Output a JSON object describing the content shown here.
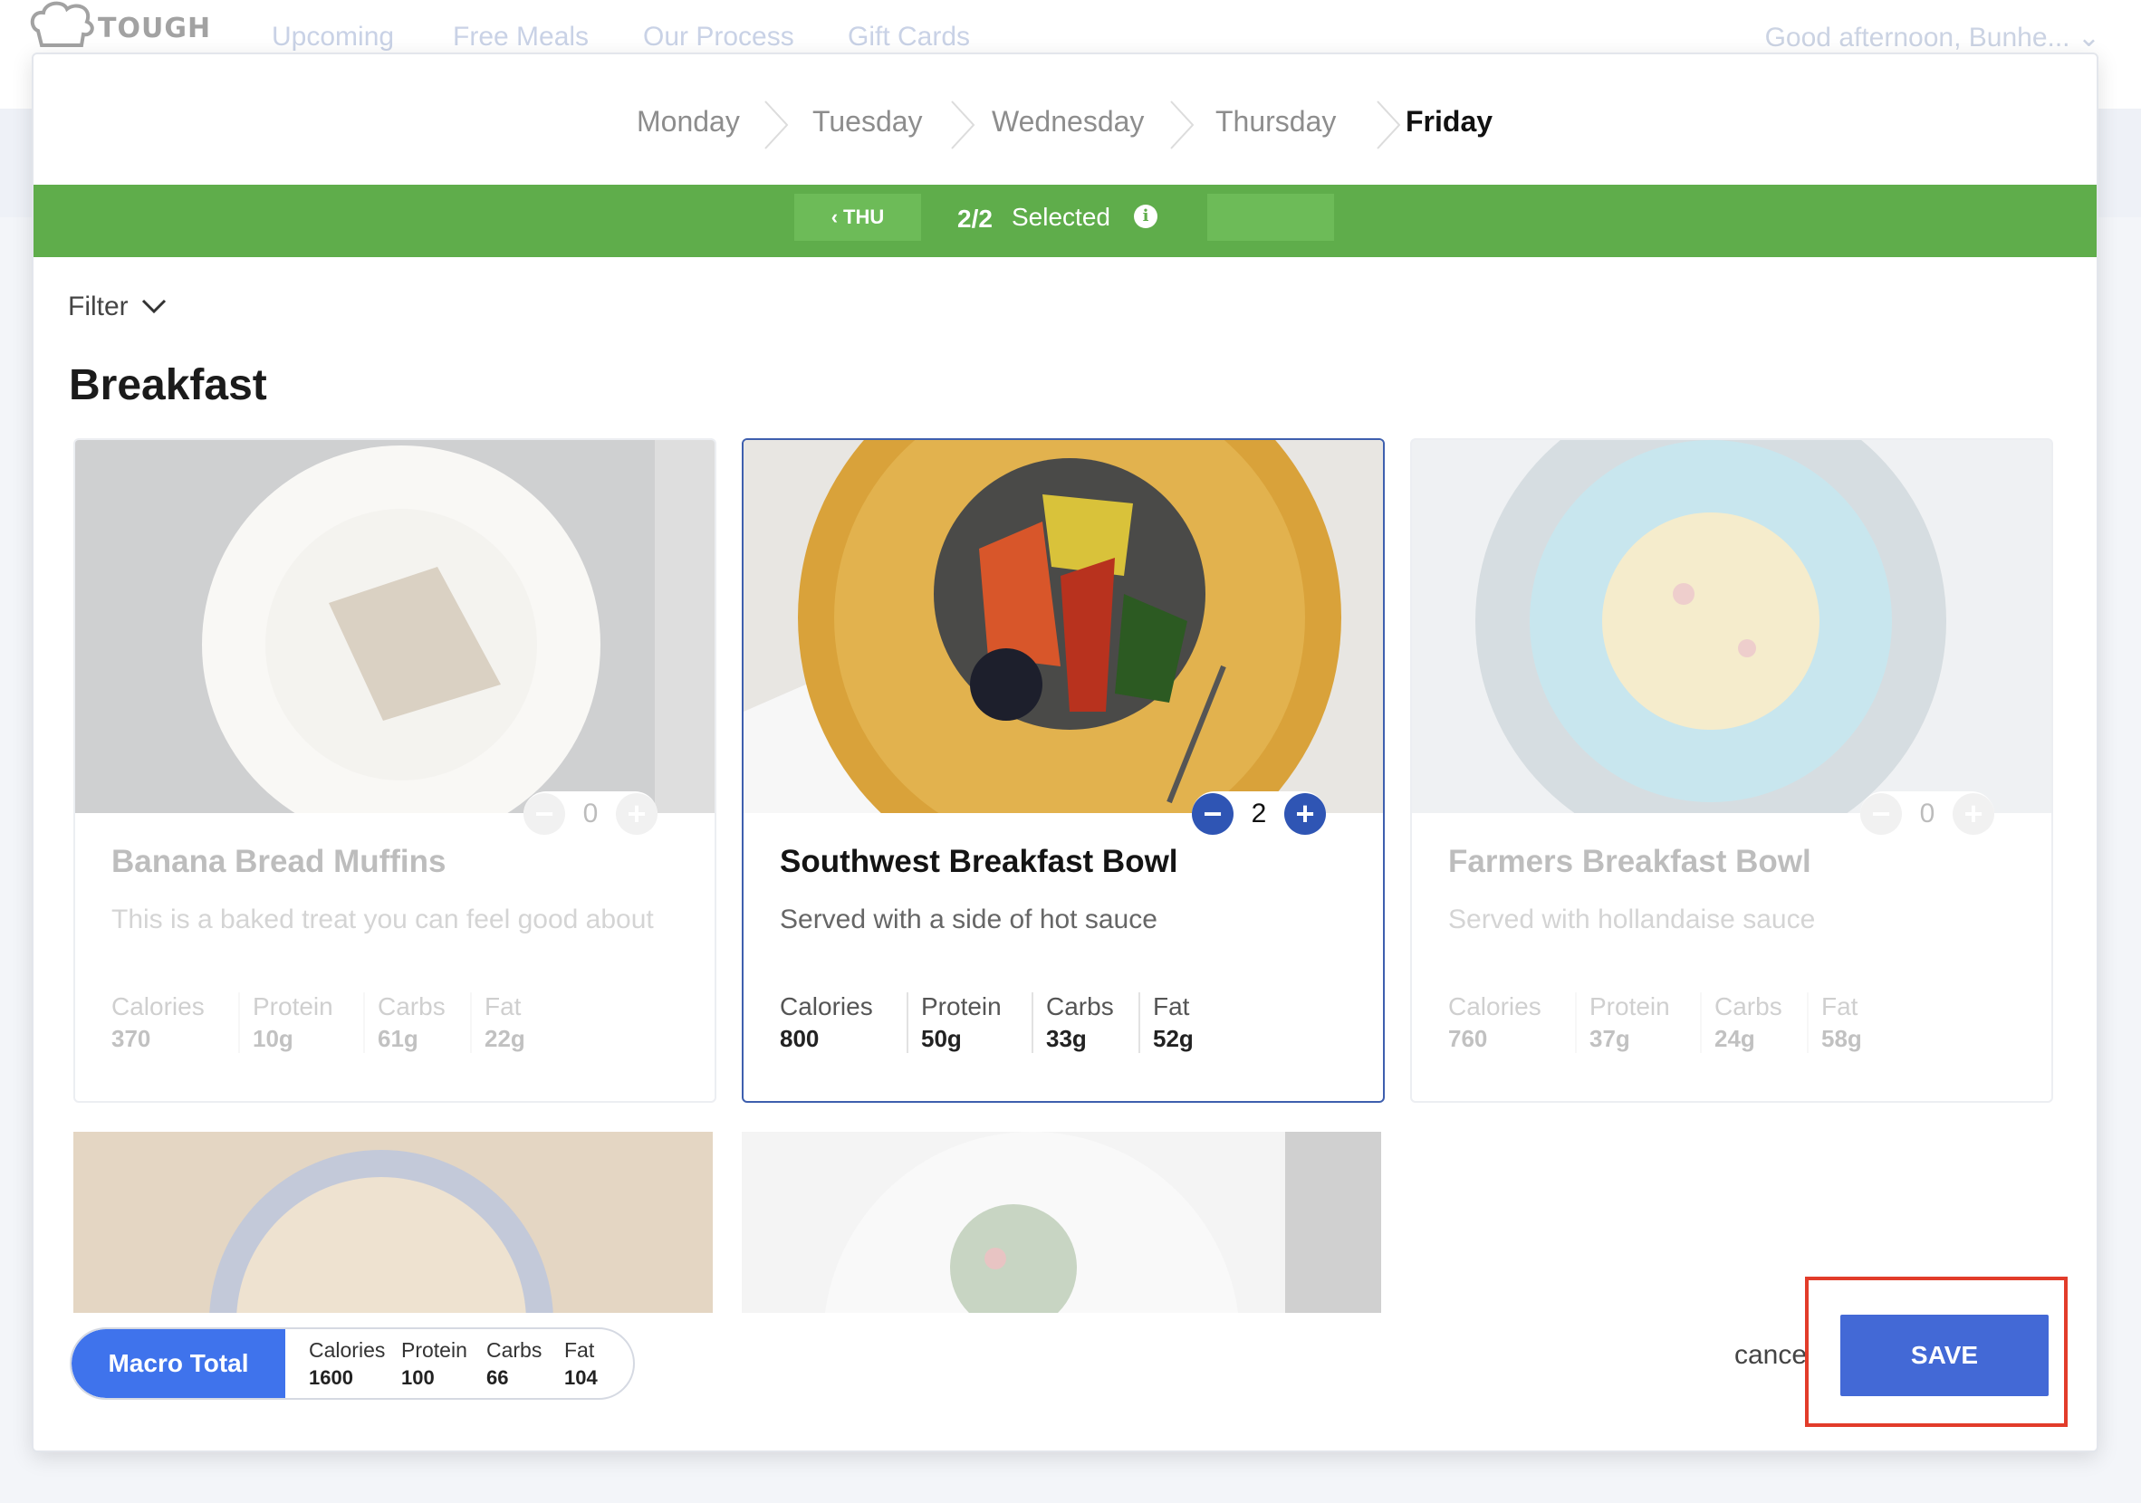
{
  "nav": {
    "logo_text": "TOUGH",
    "links": [
      "Upcoming",
      "Free Meals",
      "Our Process",
      "Gift Cards"
    ],
    "greeting": "Good afternoon, Bunhe..."
  },
  "days": [
    "Monday",
    "Tuesday",
    "Wednesday",
    "Thursday",
    "Friday"
  ],
  "active_day": "Friday",
  "selection_bar": {
    "prev_label": "THU",
    "count": "2/2",
    "label": "Selected"
  },
  "filter_label": "Filter",
  "section_title": "Breakfast",
  "cards": [
    {
      "name": "Banana Bread Muffins",
      "description": "This is a baked treat you can feel good about",
      "quantity": "0",
      "macros": [
        {
          "label": "Calories",
          "value": "370"
        },
        {
          "label": "Protein",
          "value": "10g"
        },
        {
          "label": "Carbs",
          "value": "61g"
        },
        {
          "label": "Fat",
          "value": "22g"
        }
      ]
    },
    {
      "name": "Southwest Breakfast Bowl",
      "description": "Served with a side of hot sauce",
      "quantity": "2",
      "macros": [
        {
          "label": "Calories",
          "value": "800"
        },
        {
          "label": "Protein",
          "value": "50g"
        },
        {
          "label": "Carbs",
          "value": "33g"
        },
        {
          "label": "Fat",
          "value": "52g"
        }
      ]
    },
    {
      "name": "Farmers Breakfast Bowl",
      "description": "Served with hollandaise sauce",
      "quantity": "0",
      "macros": [
        {
          "label": "Calories",
          "value": "760"
        },
        {
          "label": "Protein",
          "value": "37g"
        },
        {
          "label": "Carbs",
          "value": "24g"
        },
        {
          "label": "Fat",
          "value": "58g"
        }
      ]
    }
  ],
  "macro_total": {
    "label": "Macro Total",
    "items": [
      {
        "label": "Calories",
        "value": "1600"
      },
      {
        "label": "Protein",
        "value": "100"
      },
      {
        "label": "Carbs",
        "value": "66"
      },
      {
        "label": "Fat",
        "value": "104"
      }
    ]
  },
  "actions": {
    "cancel_label": "cance",
    "save_label": "SAVE"
  },
  "colors": {
    "green_bar": "#5fad4b",
    "primary_blue": "#4369d6",
    "highlight_red": "#e23c2a"
  }
}
